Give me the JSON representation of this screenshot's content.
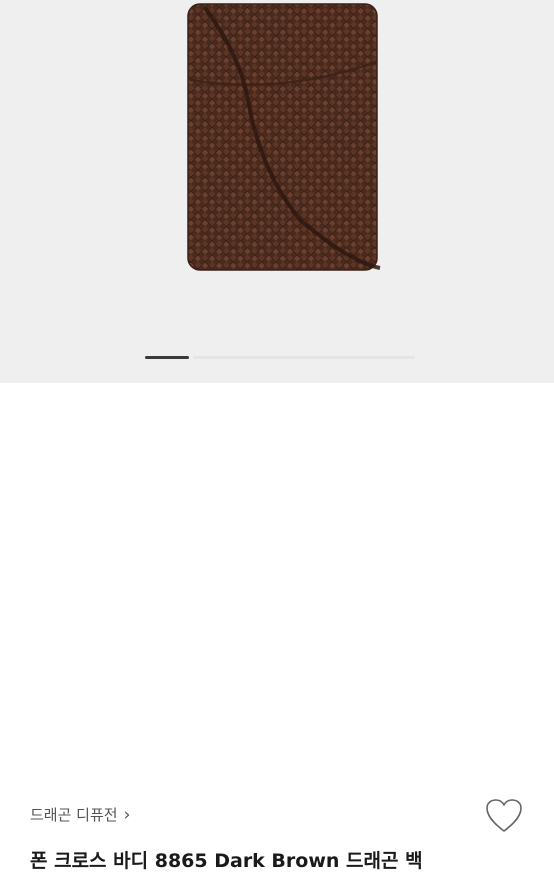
{
  "product": {
    "brand": "드래곤 디퓨전",
    "brand_chevron": "›",
    "title": "폰 크로스 바디 8865 Dark Brown 드래곤 백"
  },
  "gallery": {
    "current_index": 1,
    "total_pages": 6
  },
  "icons": {
    "wishlist": "heart-outline-icon",
    "brand_link": "chevron-right-icon"
  },
  "colors": {
    "gallery_bg": "#efeff0",
    "bag": "#4a2a1d",
    "text": "#1a1a1a"
  }
}
